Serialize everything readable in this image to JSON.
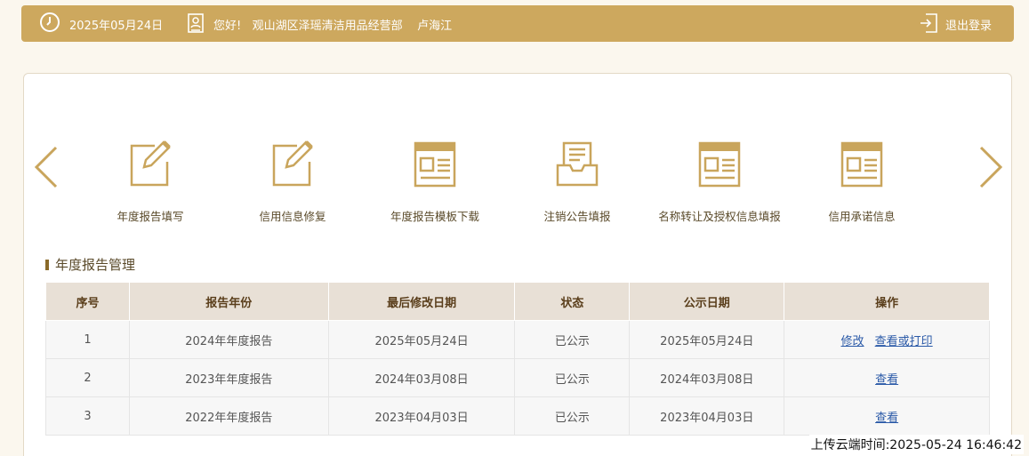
{
  "header": {
    "date": "2025年05月24日",
    "greeting": "您好!",
    "company": "观山湖区泽瑶清洁用品经营部",
    "person": "卢海江",
    "logout_label": "退出登录",
    "icons": {
      "clock": "clock-icon",
      "user": "user-card-icon",
      "logout": "logout-icon"
    }
  },
  "carousel": {
    "prev_icon": "chevron-left-icon",
    "next_icon": "chevron-right-icon",
    "items": [
      {
        "label": "年度报告填写",
        "icon": "edit-document-icon"
      },
      {
        "label": "信用信息修复",
        "icon": "edit-document-icon"
      },
      {
        "label": "年度报告模板下载",
        "icon": "template-icon"
      },
      {
        "label": "注销公告填报",
        "icon": "inbox-document-icon"
      },
      {
        "label": "名称转让及授权信息填报",
        "icon": "template-icon"
      },
      {
        "label": "信用承诺信息",
        "icon": "template-icon"
      }
    ]
  },
  "section": {
    "title": "年度报告管理"
  },
  "table": {
    "headers": [
      "序号",
      "报告年份",
      "最后修改日期",
      "状态",
      "公示日期",
      "操作"
    ],
    "rows": [
      {
        "no": "1",
        "year": "2024年年度报告",
        "modified": "2025年05月24日",
        "status": "已公示",
        "published": "2025年05月24日",
        "actions": [
          "修改",
          "查看或打印"
        ]
      },
      {
        "no": "2",
        "year": "2023年年度报告",
        "modified": "2024年03月08日",
        "status": "已公示",
        "published": "2024年03月08日",
        "actions": [
          "查看"
        ]
      },
      {
        "no": "3",
        "year": "2022年年度报告",
        "modified": "2023年04月03日",
        "status": "已公示",
        "published": "2023年04月03日",
        "actions": [
          "查看"
        ]
      }
    ]
  },
  "footer": {
    "upload_time": "上传云端时间:2025-05-24 16:46:42"
  },
  "colors": {
    "accent": "#cda85e",
    "link": "#2b5aa8",
    "header_row": "#e8e0d6"
  }
}
